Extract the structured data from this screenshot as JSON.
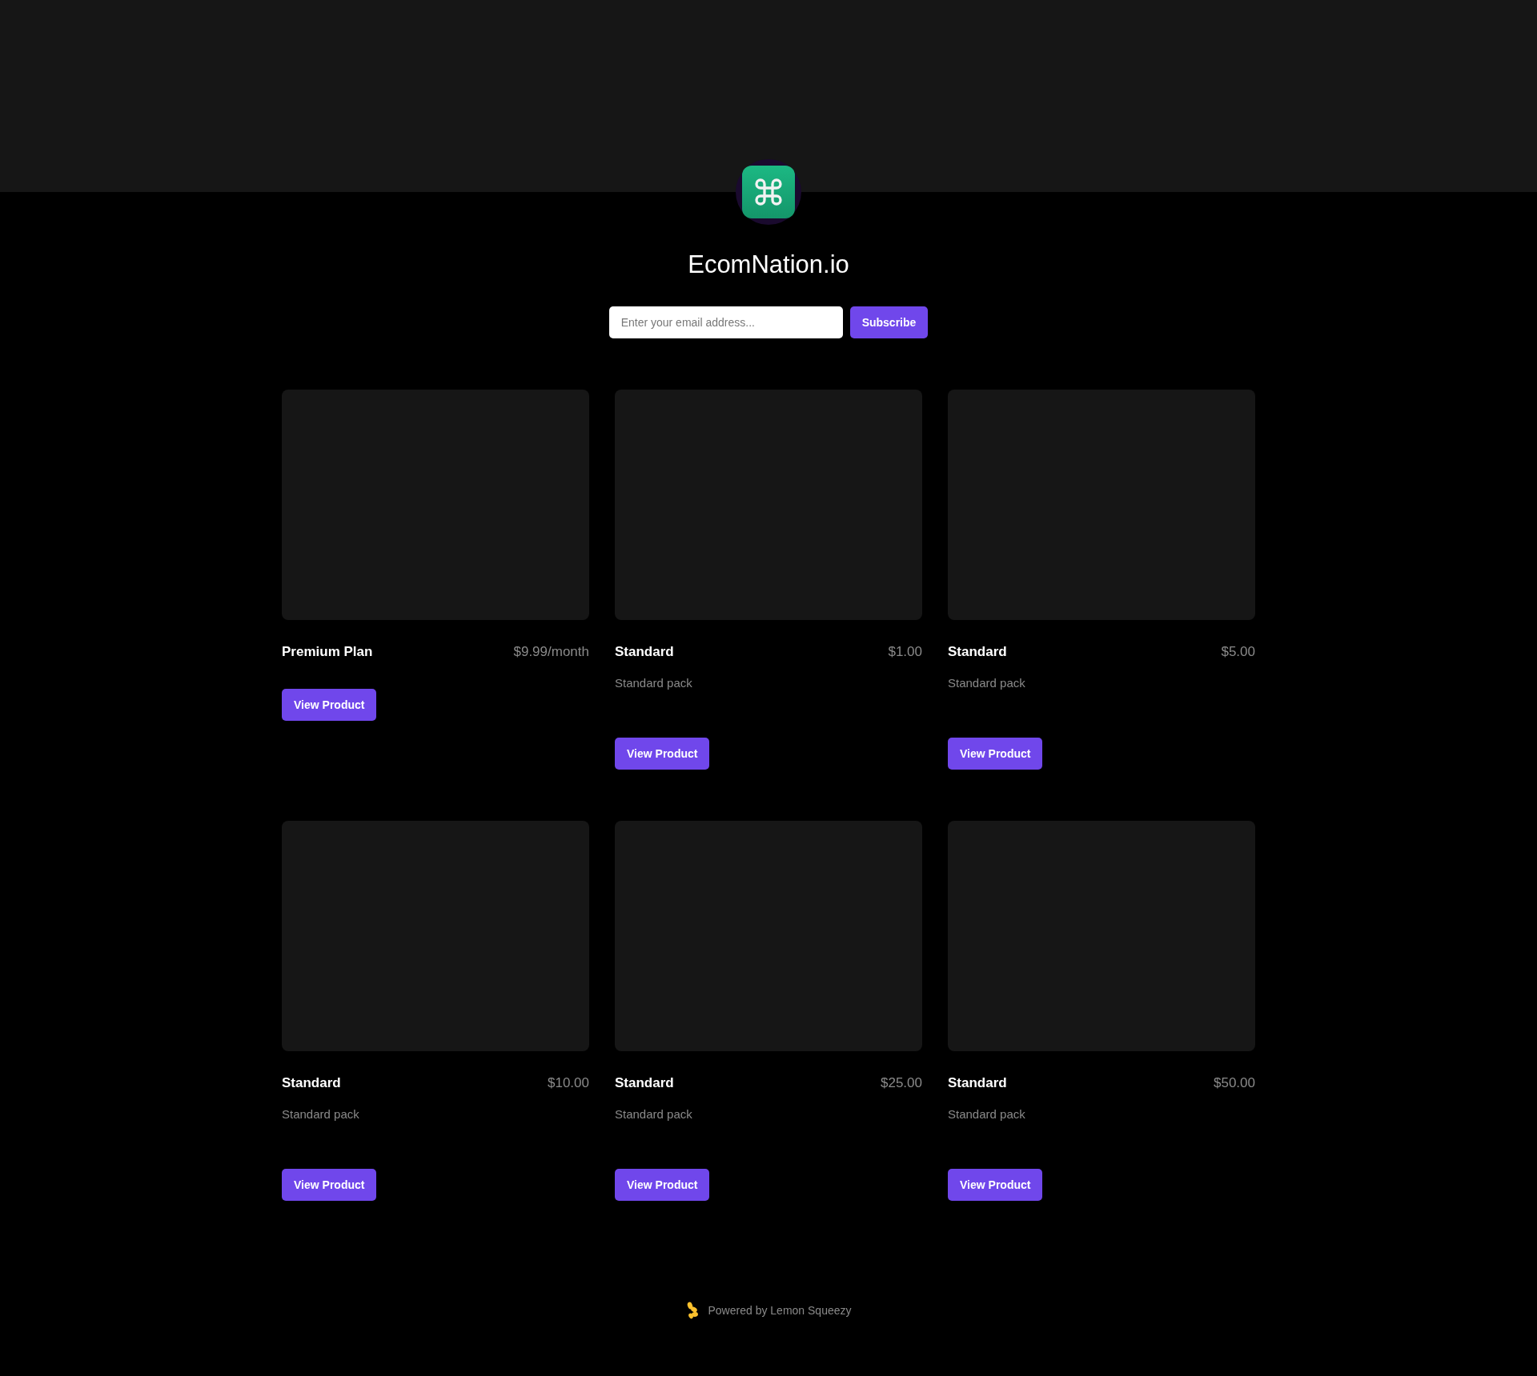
{
  "store": {
    "name": "EcomNation.io"
  },
  "subscribe": {
    "placeholder": "Enter your email address...",
    "button": "Subscribe"
  },
  "products": [
    {
      "name": "Premium Plan",
      "price": "$9.99/month",
      "button": "View Product"
    },
    {
      "name": "Standard",
      "price": "$1.00",
      "description": "Standard pack",
      "button": "View Product"
    },
    {
      "name": "Standard",
      "price": "$5.00",
      "description": "Standard pack",
      "button": "View Product"
    },
    {
      "name": "Standard",
      "price": "$10.00",
      "description": "Standard pack",
      "button": "View Product"
    },
    {
      "name": "Standard",
      "price": "$25.00",
      "description": "Standard pack",
      "button": "View Product"
    },
    {
      "name": "Standard",
      "price": "$50.00",
      "description": "Standard pack",
      "button": "View Product"
    }
  ],
  "footer": {
    "text": "Powered by Lemon Squeezy"
  }
}
